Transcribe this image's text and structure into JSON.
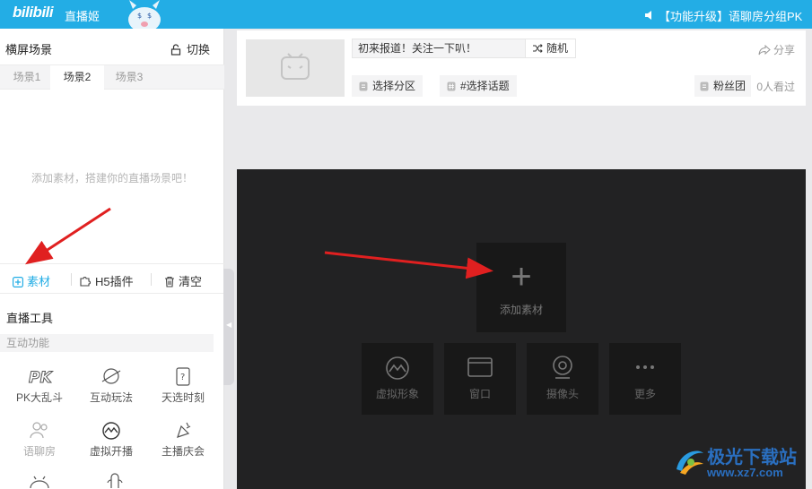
{
  "topbar": {
    "logo": "bilibili",
    "app_title": "直播姬",
    "notice": "【功能升级】语聊房分组PK"
  },
  "scene": {
    "title": "横屏场景",
    "switch_label": "切换",
    "tabs": [
      "场景1",
      "场景2",
      "场景3"
    ],
    "active_tab": "场景2",
    "empty_hint": "添加素材，搭建你的直播场景吧！",
    "actions": {
      "material": "素材",
      "h5": "H5插件",
      "clear": "清空"
    }
  },
  "tools": {
    "title": "直播工具",
    "interactive_title": "互动功能",
    "items": [
      "PK大乱斗",
      "互动玩法",
      "天选时刻",
      "语聊房",
      "虚拟开播",
      "主播庆会"
    ]
  },
  "room": {
    "title_value": "初来报道！关注一下叭！",
    "random_label": "随机",
    "share_label": "分享",
    "area_label": "选择分区",
    "topic_label": "#选择话题",
    "fan_club_label": "粉丝团",
    "viewers": "0人看过"
  },
  "preview": {
    "add_label": "添加素材",
    "sources": [
      "虚拟形象",
      "窗口",
      "摄像头",
      "更多"
    ]
  },
  "watermark": {
    "name": "极光下载站",
    "url": "www.xz7.com"
  },
  "colors": {
    "accent": "#23ade5",
    "annotation_arrow": "#e02020"
  }
}
